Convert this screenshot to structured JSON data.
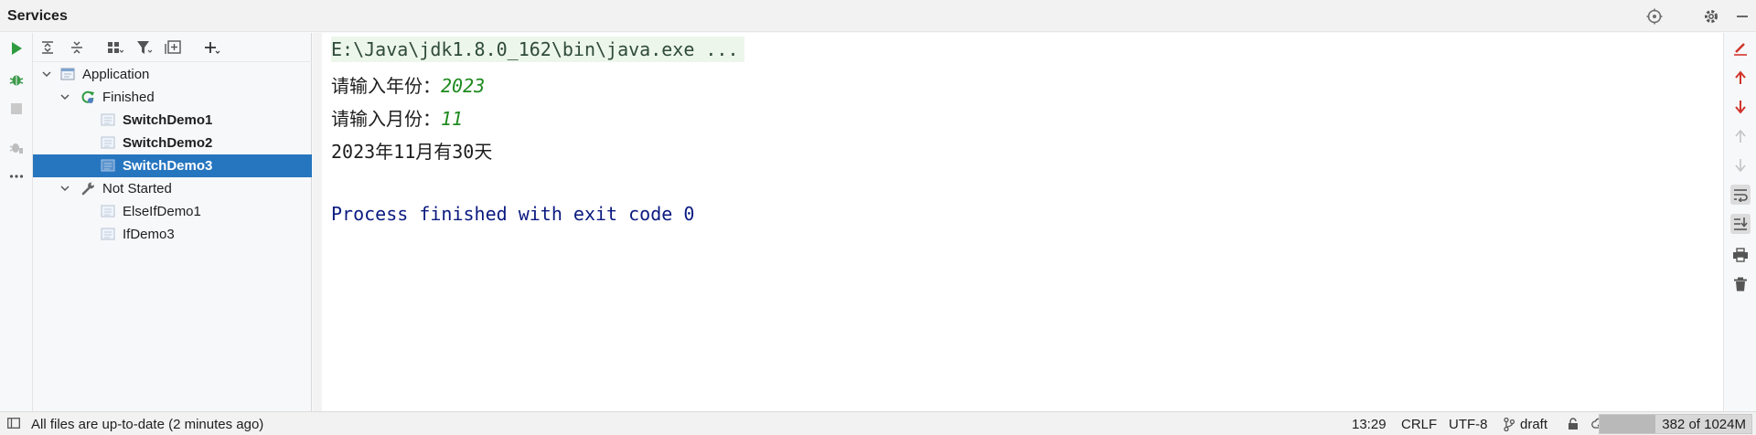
{
  "titlebar": {
    "title": "Services"
  },
  "tree": {
    "items": [
      {
        "label": "Application"
      },
      {
        "label": "Finished"
      },
      {
        "label": "SwitchDemo1"
      },
      {
        "label": "SwitchDemo2"
      },
      {
        "label": "SwitchDemo3"
      },
      {
        "label": "Not Started"
      },
      {
        "label": "ElseIfDemo1"
      },
      {
        "label": "IfDemo3"
      }
    ]
  },
  "console": {
    "command": "E:\\Java\\jdk1.8.0_162\\bin\\java.exe ...",
    "prompt_year": "请输入年份：",
    "input_year": "2023",
    "prompt_month": "请输入月份：",
    "input_month": "11",
    "result": "2023年11月有30天",
    "finished": "Process finished with exit code 0"
  },
  "statusbar": {
    "message": "All files are up-to-date (2 minutes ago)",
    "position": "13:29",
    "line_ending": "CRLF",
    "encoding": "UTF-8",
    "branch": "draft",
    "memory": "382 of 1024M",
    "memory_fraction": 0.37
  },
  "colors": {
    "selection": "#2675bf",
    "run_green": "#2e9c3f",
    "stop_red": "#d0342c"
  }
}
